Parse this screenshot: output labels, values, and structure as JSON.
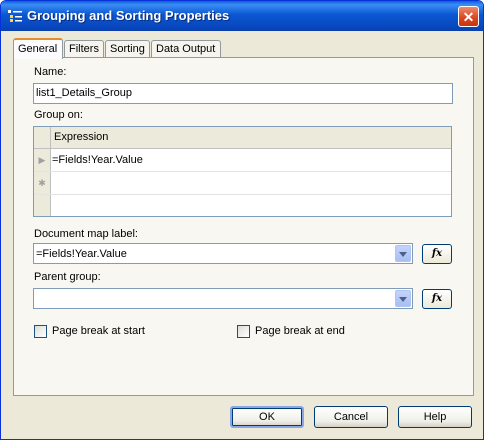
{
  "window": {
    "title": "Grouping and Sorting Properties",
    "close_glyph": "✕"
  },
  "tabs": [
    {
      "label": "General"
    },
    {
      "label": "Filters"
    },
    {
      "label": "Sorting"
    },
    {
      "label": "Data Output"
    }
  ],
  "form": {
    "name_label": "Name:",
    "name_value": "list1_Details_Group",
    "group_on_label": "Group on:",
    "grid": {
      "column_header": "Expression",
      "rows": [
        {
          "marker": "▶",
          "expression": "=Fields!Year.Value"
        },
        {
          "marker": "✱",
          "expression": ""
        },
        {
          "marker": "",
          "expression": ""
        }
      ]
    },
    "doc_map_label": "Document map label:",
    "doc_map_value": "=Fields!Year.Value",
    "parent_group_label": "Parent group:",
    "parent_group_value": "",
    "fx_label": "fx",
    "page_break_start_label": "Page break at start",
    "page_break_start_checked": false,
    "page_break_end_label": "Page break at end",
    "page_break_end_checked": false
  },
  "buttons": {
    "ok": "OK",
    "cancel": "Cancel",
    "help": "Help"
  }
}
